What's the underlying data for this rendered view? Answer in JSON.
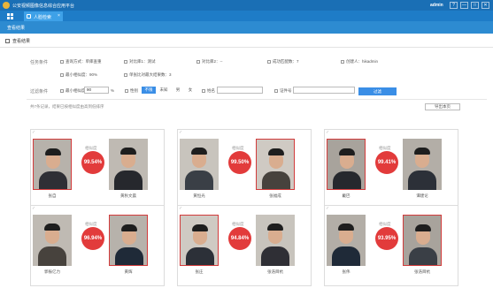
{
  "app": {
    "title": "公安视频图像信息综合应用平台",
    "user": "admin",
    "win_buttons": [
      "?",
      "—",
      "□",
      "✕"
    ]
  },
  "tabs": {
    "home_icon": "grid-icon",
    "active_tab": "人脸检索",
    "close": "×"
  },
  "subheader": {
    "title": "查看结果"
  },
  "breadcrumb": {
    "text": "查看结果"
  },
  "conditions": {
    "task_label": "任务条件",
    "fields": [
      {
        "label": "查询方式：",
        "value": "单库查重"
      },
      {
        "label": "对比库1：",
        "value": "测试"
      },
      {
        "label": "对比库2：",
        "value": "--"
      },
      {
        "label": "成功匹配数：",
        "value": "7"
      },
      {
        "label": "创建人：",
        "value": "hikadmin"
      }
    ],
    "fields2": [
      {
        "label": "最小相似度：",
        "value": "90%"
      },
      {
        "label": "单张比对最大结果数：",
        "value": "3"
      }
    ]
  },
  "filter": {
    "label": "过滤条件",
    "min_sim_label": "最小相似度",
    "min_sim_value": "90",
    "percent": "%",
    "gender_label": "性别",
    "gender_options": [
      "不限",
      "未知",
      "男",
      "女"
    ],
    "name_label": "姓名",
    "name_value": "",
    "id_label": "证件号",
    "id_value": "",
    "search_button": "过滤"
  },
  "results": {
    "summary": "共7条记录，结果已按相似度由高到低排序",
    "export": "导出本页",
    "score_label": "相似度",
    "cards": [
      {
        "score": "99.54%",
        "left_name": "张自",
        "right_name": "黄秋文晨"
      },
      {
        "score": "99.50%",
        "left_name": "黄恒光",
        "right_name": "张福成"
      },
      {
        "score": "99.41%",
        "left_name": "戴巴",
        "right_name": "谭建论"
      },
      {
        "score": "96.94%",
        "left_name": "郭振亿力",
        "right_name": "黄辉"
      },
      {
        "score": "94.84%",
        "left_name": "张庄",
        "right_name": "张浩目杭"
      },
      {
        "score": "93.95%",
        "left_name": "张伟",
        "right_name": "张浩目杭"
      }
    ]
  },
  "colors": {
    "topbar": "#1a6fb5",
    "accent": "#3a8ee6",
    "score": "#e23b3b",
    "frame": "#d23b3b"
  }
}
